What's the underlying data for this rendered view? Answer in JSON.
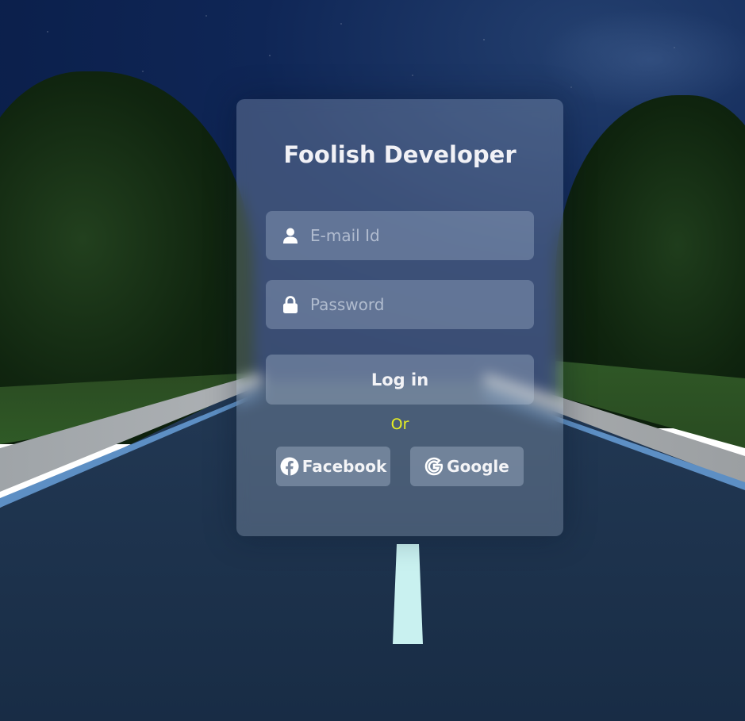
{
  "brand": {
    "title": "Foolish Developer"
  },
  "form": {
    "email_placeholder": "E-mail Id",
    "password_placeholder": "Password",
    "login_label": "Log in",
    "divider_text": "Or"
  },
  "social": {
    "facebook_label": "Facebook",
    "google_label": "Google"
  },
  "icons": {
    "email": "user-icon",
    "password": "lock-icon",
    "facebook": "facebook-icon",
    "google": "google-icon"
  },
  "colors": {
    "divider_text": "#e7ef22",
    "title_text": "#f1f1f6"
  }
}
